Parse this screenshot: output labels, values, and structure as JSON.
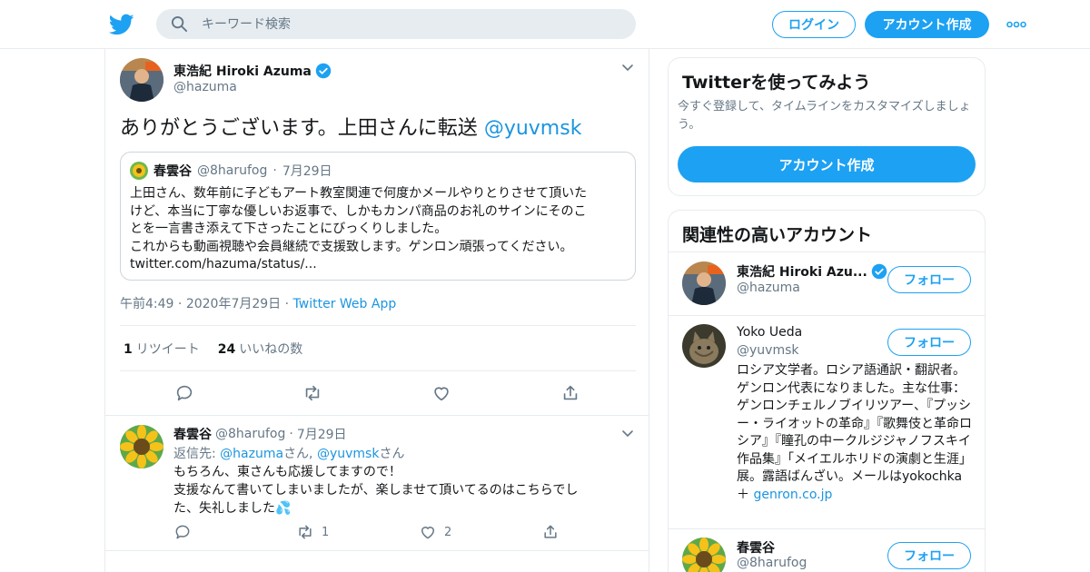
{
  "colors": {
    "accent": "#1da1f2",
    "link": "#1b95e0",
    "border": "#e6ecf0",
    "muted": "#657786"
  },
  "header": {
    "logo_icon": "twitter-bird-icon",
    "search_placeholder": "キーワード検索",
    "login_label": "ログイン",
    "signup_label": "アカウント作成",
    "more_icon": "more-dots-icon"
  },
  "tweet": {
    "author_name": "東浩紀 Hiroki Azuma",
    "author_handle": "@hazuma",
    "text": "ありがとうございます。上田さんに転送",
    "mention": "@yuvmsk",
    "quote": {
      "name": "春雲谷",
      "handle": "@8harufog",
      "date": "7月29日",
      "text_lines": [
        "上田さん、数年前に子どもアート教室関連で何度かメールやりとりさせて頂いた",
        "けど、本当に丁寧な優しいお返事で、しかもカンパ商品のお礼のサインにそのこ",
        "とを一言書き添えて下さったことにびっくりしました。",
        "これからも動画視聴や会員継続で支援致します。ゲンロン頑張ってください。",
        "twitter.com/hazuma/status/..."
      ]
    },
    "time": "午前4:49",
    "date": "2020年7月29日",
    "source": "Twitter Web App",
    "retweets_count": "1",
    "retweets_label": "リツイート",
    "likes_count": "24",
    "likes_label": "いいねの数"
  },
  "reply": {
    "name": "春雲谷",
    "handle": "@8harufog",
    "date": "7月29日",
    "reply_prefix": "返信先: ",
    "reply_to_1": "@hazuma",
    "reply_suffix_1": "さん, ",
    "reply_to_2": "@yuvmsk",
    "reply_suffix_2": "さん",
    "body_lines": [
      "もちろん、東さんも応援してますので！",
      "支援なんて書いてしまいましたが、楽しませて頂いてるのはこちらでし",
      "た、失礼しました💦"
    ],
    "retweets": "1",
    "likes": "2"
  },
  "sidebar": {
    "signup_card": {
      "title": "Twitterを使ってみよう",
      "desc": "今すぐ登録して、タイムラインをカスタマイズしましょう。",
      "button": "アカウント作成"
    },
    "related": {
      "title": "関連性の高いアカウント",
      "follow_label": "フォロー",
      "accounts": [
        {
          "name": "東浩紀 Hiroki Azu...",
          "handle": "@hazuma",
          "verified": true
        },
        {
          "name": "Yoko Ueda",
          "handle": "@yuvmsk",
          "verified": false,
          "bio": "ロシア文学者。ロシア語通訳・翻訳者。ゲンロン代表になりました。主な仕事：ゲンロンチェルノブイリツアー、『プッシー・ライオットの革命』『歌舞伎と革命ロシア』『瞳孔の中ークルジジャノフスキイ作品集』「メイエルホリドの演劇と生涯」展。露語ばんざい。メールはyokochka",
          "bio_link_prefix": "＋",
          "bio_link": "genron.co.jp"
        },
        {
          "name": "春雲谷",
          "handle": "@8harufog",
          "verified": false
        }
      ]
    }
  }
}
